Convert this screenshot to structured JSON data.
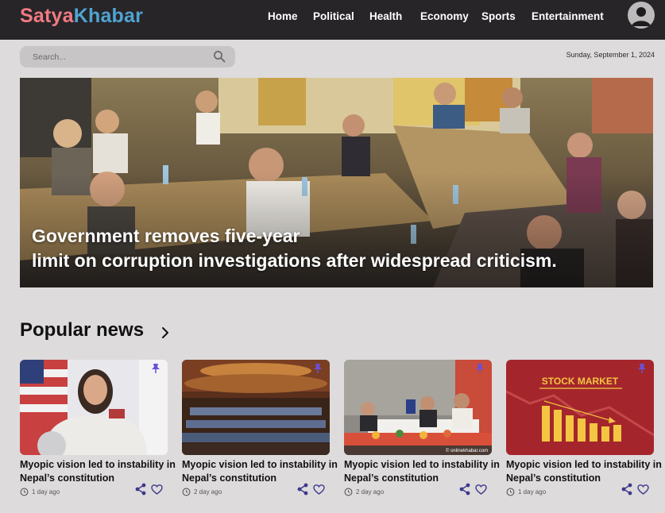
{
  "brand": {
    "part1": "Satya",
    "part2": "Khabar"
  },
  "nav": {
    "items": [
      {
        "label": "Home"
      },
      {
        "label": "Political"
      },
      {
        "label": "Health"
      },
      {
        "label": "Economy"
      },
      {
        "label": "Sports"
      },
      {
        "label": "Entertainment"
      }
    ]
  },
  "search": {
    "placeholder": "Search..."
  },
  "date": "Sunday, September 1, 2024",
  "hero": {
    "line1": "Government removes five-year",
    "line2": "limit on corruption investigations after widespread criticism."
  },
  "popular": {
    "title": "Popular news",
    "cards": [
      {
        "title": "Myopic vision led to instability in Nepal’s constitution",
        "time": "1 day ago"
      },
      {
        "title": "Myopic vision led to instability in Nepal’s constitution",
        "time": "2 day ago"
      },
      {
        "title": "Myopic vision led to instability in Nepal’s constitution",
        "time": "2 day ago"
      },
      {
        "title": "Myopic vision led to instability in Nepal’s constitution",
        "time": "1 day ago"
      }
    ]
  },
  "thumbs": {
    "stock_label": "STOCK MARKET",
    "watermark": "© onlinekhabar.com"
  },
  "colors": {
    "topbar": "#272528",
    "brand_part1": "#f07a82",
    "brand_part2": "#4fa3d1",
    "page_bg": "#dedbdc",
    "pin": "#6b4fd6",
    "icon": "#3d3a8c"
  },
  "icons": [
    "user-avatar-icon",
    "search-icon",
    "chevron-right-icon",
    "pin-icon",
    "clock-icon",
    "share-icon",
    "heart-icon"
  ]
}
